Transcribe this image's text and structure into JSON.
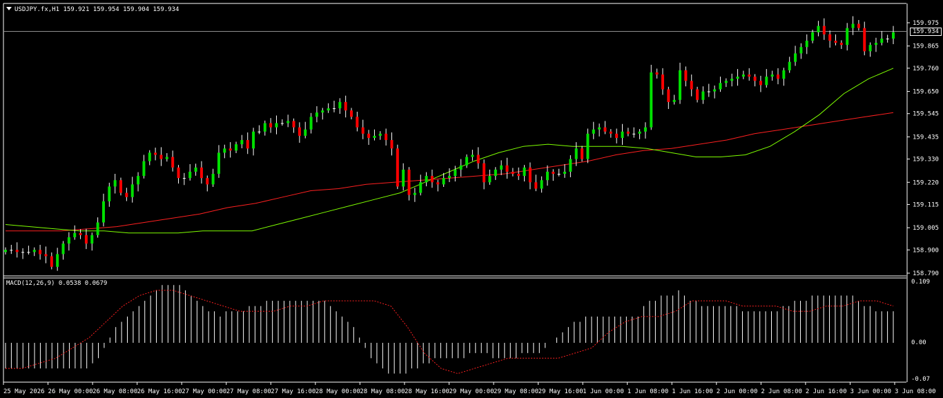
{
  "window": {
    "symbol_header": "USDJPY.fx,H1  159.921 159.954 159.904 159.934",
    "current_price_tag": "159.934"
  },
  "macd": {
    "header": "MACD(12,26,9) 0.0538 0.0679",
    "scale": [
      "0.109",
      "0.00",
      "-0.07"
    ]
  },
  "colors": {
    "background": "#000000",
    "bull_candle": "#00e000",
    "bear_candle": "#ff0000",
    "ma_fast": "#7fff00",
    "ma_slow": "#ff2020",
    "macd_hist": "#ffffff",
    "macd_signal": "#ff2020",
    "frame": "#ffffff"
  },
  "chart_data": {
    "type": "candlestick",
    "price_scale": {
      "ticks": [
        "159.975",
        "159.865",
        "159.760",
        "159.650",
        "159.545",
        "159.435",
        "159.330",
        "159.220",
        "159.115",
        "159.005",
        "158.900",
        "158.790"
      ],
      "ylim": [
        158.79,
        159.975
      ],
      "current_price": 159.934
    },
    "time_labels": [
      "25 May 2026",
      "26 May 00:00",
      "26 May 08:00",
      "26 May 16:00",
      "27 May 00:00",
      "27 May 08:00",
      "27 May 16:00",
      "28 May 00:00",
      "28 May 08:00",
      "28 May 16:00",
      "29 May 00:00",
      "29 May 08:00",
      "29 May 16:00",
      "1 Jun 00:00",
      "1 Jun 08:00",
      "1 Jun 16:00",
      "2 Jun 00:00",
      "2 Jun 08:00",
      "2 Jun 16:00",
      "3 Jun 00:00",
      "3 Jun 08:00"
    ],
    "close": [
      158.9,
      158.9,
      158.89,
      158.89,
      158.89,
      158.9,
      158.88,
      158.87,
      158.82,
      158.88,
      158.93,
      158.96,
      158.98,
      158.97,
      158.93,
      158.97,
      159.03,
      159.13,
      159.2,
      159.23,
      159.17,
      159.15,
      159.21,
      159.25,
      159.32,
      159.36,
      159.35,
      159.33,
      159.34,
      159.29,
      159.24,
      159.24,
      159.27,
      159.29,
      159.24,
      159.21,
      159.26,
      159.36,
      159.38,
      159.37,
      159.4,
      159.42,
      159.38,
      159.46,
      159.46,
      159.5,
      159.48,
      159.5,
      159.5,
      159.51,
      159.48,
      159.44,
      159.47,
      159.53,
      159.55,
      159.56,
      159.57,
      159.57,
      159.6,
      159.56,
      159.53,
      159.48,
      159.45,
      159.43,
      159.44,
      159.45,
      159.42,
      159.38,
      159.2,
      159.28,
      159.16,
      159.17,
      159.22,
      159.25,
      159.22,
      159.21,
      159.24,
      159.25,
      159.28,
      159.3,
      159.34,
      159.35,
      159.31,
      159.22,
      159.25,
      159.28,
      159.3,
      159.27,
      159.26,
      159.25,
      159.29,
      159.22,
      159.19,
      159.23,
      159.27,
      159.26,
      159.26,
      159.27,
      159.33,
      159.38,
      159.33,
      159.45,
      159.47,
      159.48,
      159.46,
      159.45,
      159.43,
      159.46,
      159.45,
      159.45,
      159.46,
      159.48,
      159.74,
      159.73,
      159.66,
      159.6,
      159.61,
      159.75,
      159.7,
      159.66,
      159.61,
      159.65,
      159.65,
      159.66,
      159.69,
      159.7,
      159.71,
      159.72,
      159.73,
      159.72,
      159.7,
      159.68,
      159.72,
      159.73,
      159.71,
      159.75,
      159.79,
      159.83,
      159.86,
      159.89,
      159.93,
      159.96,
      159.92,
      159.89,
      159.88,
      159.87,
      159.95,
      159.97,
      159.95,
      159.84,
      159.87,
      159.88,
      159.9,
      159.9,
      159.93
    ],
    "ma_fast": [
      159.02,
      159.01,
      159.0,
      158.99,
      158.99,
      158.98,
      158.98,
      158.98,
      158.99,
      158.99,
      158.99,
      159.02,
      159.05,
      159.08,
      159.11,
      159.14,
      159.17,
      159.22,
      159.27,
      159.32,
      159.36,
      159.39,
      159.4,
      159.39,
      159.39,
      159.39,
      159.38,
      159.36,
      159.34,
      159.34,
      159.35,
      159.39,
      159.46,
      159.54,
      159.64,
      159.71,
      159.76
    ],
    "ma_slow": [
      158.99,
      158.99,
      158.99,
      159.0,
      159.01,
      159.03,
      159.05,
      159.07,
      159.1,
      159.12,
      159.15,
      159.18,
      159.19,
      159.21,
      159.22,
      159.23,
      159.24,
      159.25,
      159.26,
      159.28,
      159.3,
      159.32,
      159.35,
      159.37,
      159.38,
      159.4,
      159.42,
      159.45,
      159.47,
      159.49,
      159.51,
      159.53,
      159.55
    ],
    "macd_histogram": [
      -0.05,
      -0.05,
      -0.05,
      -0.05,
      -0.05,
      -0.05,
      -0.05,
      -0.05,
      -0.05,
      -0.05,
      -0.05,
      -0.05,
      -0.05,
      -0.05,
      -0.05,
      -0.04,
      -0.03,
      -0.01,
      0.01,
      0.03,
      0.04,
      0.05,
      0.06,
      0.07,
      0.08,
      0.09,
      0.1,
      0.11,
      0.11,
      0.11,
      0.11,
      0.1,
      0.09,
      0.08,
      0.07,
      0.06,
      0.06,
      0.05,
      0.06,
      0.06,
      0.06,
      0.06,
      0.07,
      0.07,
      0.07,
      0.08,
      0.08,
      0.08,
      0.08,
      0.08,
      0.08,
      0.08,
      0.08,
      0.08,
      0.08,
      0.08,
      0.07,
      0.06,
      0.05,
      0.04,
      0.03,
      0.01,
      -0.01,
      -0.03,
      -0.04,
      -0.05,
      -0.06,
      -0.06,
      -0.06,
      -0.06,
      -0.05,
      -0.05,
      -0.04,
      -0.04,
      -0.03,
      -0.03,
      -0.03,
      -0.03,
      -0.03,
      -0.03,
      -0.02,
      -0.02,
      -0.02,
      -0.02,
      -0.03,
      -0.03,
      -0.03,
      -0.03,
      -0.03,
      -0.02,
      -0.02,
      -0.02,
      -0.02,
      -0.01,
      0.0,
      0.01,
      0.02,
      0.03,
      0.04,
      0.04,
      0.05,
      0.05,
      0.05,
      0.05,
      0.05,
      0.05,
      0.05,
      0.05,
      0.05,
      0.05,
      0.07,
      0.08,
      0.08,
      0.09,
      0.09,
      0.09,
      0.1,
      0.09,
      0.08,
      0.08,
      0.07,
      0.07,
      0.07,
      0.07,
      0.07,
      0.07,
      0.07,
      0.06,
      0.06,
      0.06,
      0.06,
      0.06,
      0.06,
      0.06,
      0.07,
      0.07,
      0.08,
      0.08,
      0.08,
      0.09,
      0.09,
      0.09,
      0.09,
      0.09,
      0.09,
      0.09,
      0.09,
      0.08,
      0.07,
      0.07,
      0.06,
      0.06,
      0.06,
      0.06
    ],
    "macd_signal": [
      -0.05,
      -0.05,
      -0.04,
      -0.03,
      -0.01,
      0.01,
      0.04,
      0.07,
      0.09,
      0.1,
      0.1,
      0.09,
      0.08,
      0.07,
      0.06,
      0.06,
      0.06,
      0.07,
      0.07,
      0.08,
      0.08,
      0.08,
      0.08,
      0.07,
      0.03,
      -0.02,
      -0.05,
      -0.06,
      -0.05,
      -0.04,
      -0.03,
      -0.03,
      -0.03,
      -0.03,
      -0.02,
      -0.01,
      0.02,
      0.04,
      0.05,
      0.05,
      0.06,
      0.08,
      0.08,
      0.08,
      0.07,
      0.07,
      0.07,
      0.06,
      0.06,
      0.07,
      0.07,
      0.08,
      0.08,
      0.07
    ]
  }
}
